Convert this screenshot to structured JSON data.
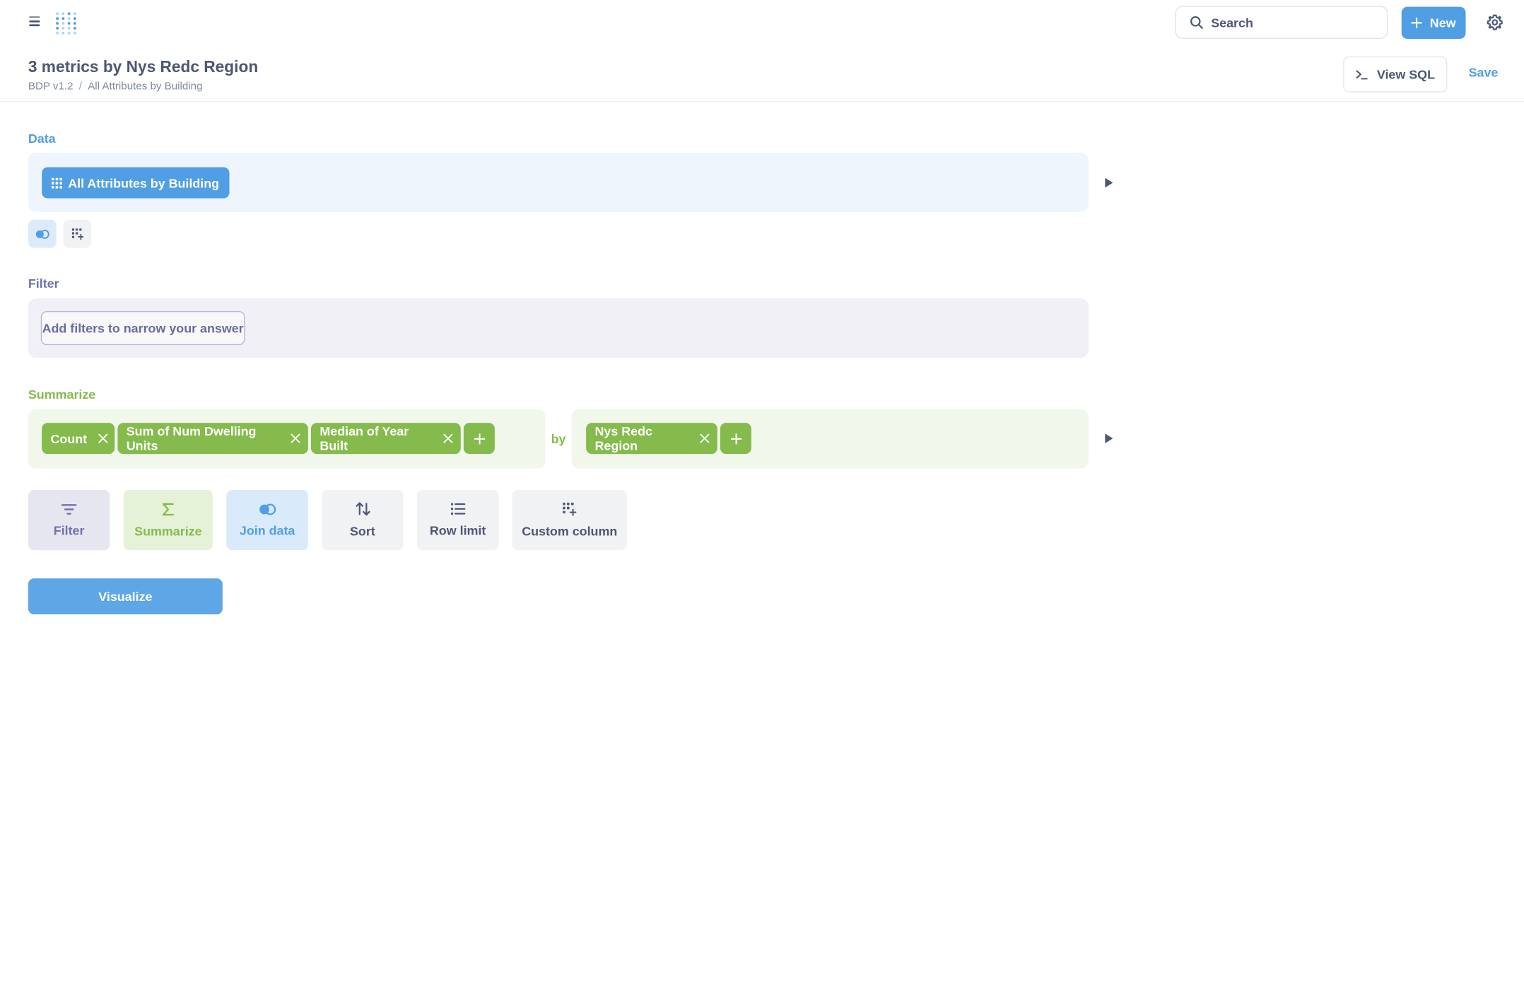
{
  "nav": {
    "search_placeholder": "Search",
    "new_label": "New"
  },
  "header": {
    "title": "3 metrics by Nys Redc Region",
    "breadcrumb": [
      "BDP v1.2",
      "All Attributes by Building"
    ],
    "breadcrumb_sep": "/",
    "view_sql_label": "View SQL",
    "save_label": "Save"
  },
  "sections": {
    "data_label": "Data",
    "filter_label": "Filter",
    "summarize_label": "Summarize"
  },
  "data": {
    "source": "All Attributes by Building"
  },
  "filter": {
    "placeholder_button": "Add filters to narrow your answer"
  },
  "summarize": {
    "metrics": [
      "Count",
      "Sum of Num Dwelling Units",
      "Median of Year Built"
    ],
    "by_label": "by",
    "groupings": [
      "Nys Redc Region"
    ]
  },
  "actions": {
    "filter": "Filter",
    "summarize": "Summarize",
    "join": "Join data",
    "sort": "Sort",
    "row_limit": "Row limit",
    "custom_column": "Custom column"
  },
  "visualize_label": "Visualize",
  "colors": {
    "brand": "#509ee3",
    "filter": "#7172ad",
    "summarize": "#84bb4c",
    "text": "#4c5773"
  },
  "icons": [
    "menu-icon",
    "metabase-logo",
    "search-icon",
    "plus-icon",
    "gear-icon",
    "terminal-icon",
    "table-icon",
    "join-icon",
    "add-column-icon",
    "close-icon",
    "filter-icon",
    "sigma-icon",
    "sort-icon",
    "list-icon",
    "triangle-right-icon"
  ]
}
